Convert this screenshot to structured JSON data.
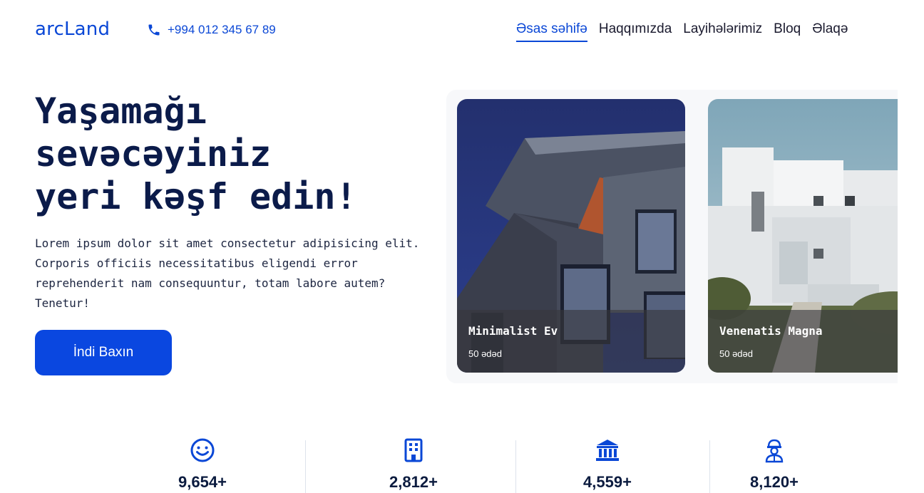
{
  "brand": {
    "logo": "arcLand",
    "phone": "+994 012 345 67 89"
  },
  "nav": {
    "items": [
      {
        "label": "Əsas səhifə",
        "active": true
      },
      {
        "label": "Haqqımızda",
        "active": false
      },
      {
        "label": "Layihələrimiz",
        "active": false
      },
      {
        "label": "Bloq",
        "active": false
      },
      {
        "label": "Əlaqə",
        "active": false
      }
    ]
  },
  "hero": {
    "title_lines": [
      "Yaşamağı",
      "sevəcəyiniz",
      "yeri kəşf edin!"
    ],
    "text": "Lorem ipsum dolor sit amet consectetur adipisicing elit. Corporis officiis necessitatibus eligendi error reprehenderit nam consequuntur, totam labore autem? Tenetur!",
    "cta_label": "İndi Baxın"
  },
  "cards": [
    {
      "name": "Minimalist Ev",
      "count": "50 ədəd"
    },
    {
      "name": "Venenatis Magna",
      "count": "50 ədəd"
    }
  ],
  "stats": [
    {
      "icon": "smile-icon",
      "value": "9,654+"
    },
    {
      "icon": "building-icon",
      "value": "2,812+"
    },
    {
      "icon": "bank-icon",
      "value": "4,559+"
    },
    {
      "icon": "worker-icon",
      "value": "8,120+"
    }
  ],
  "colors": {
    "accent": "#0a47d6",
    "heading": "#0b1b4a"
  }
}
